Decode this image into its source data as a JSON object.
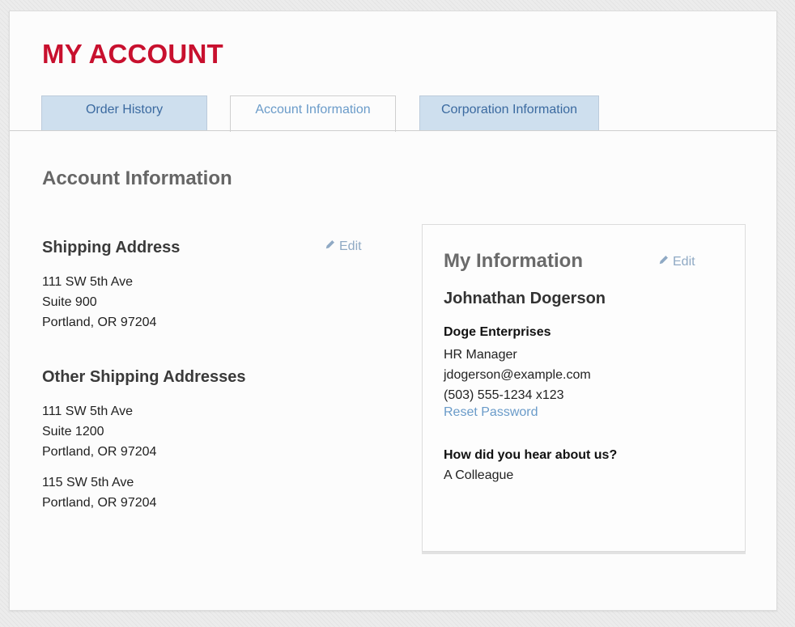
{
  "page": {
    "title": "MY ACCOUNT"
  },
  "tabs": [
    {
      "label": "Order History"
    },
    {
      "label": "Account Information"
    },
    {
      "label": "Corporation Information"
    }
  ],
  "main": {
    "section_title": "Account Information",
    "edit_label": "Edit",
    "shipping": {
      "title": "Shipping Address",
      "lines": [
        "111 SW 5th Ave",
        "Suite 900",
        "Portland, OR 97204"
      ]
    },
    "other_shipping": {
      "title": "Other Shipping Addresses",
      "addresses": [
        {
          "lines": [
            "111 SW 5th Ave",
            "Suite 1200",
            "Portland, OR 97204"
          ]
        },
        {
          "lines": [
            "115 SW 5th Ave",
            "Portland, OR 97204"
          ]
        }
      ]
    }
  },
  "my_info": {
    "title": "My Information",
    "name": "Johnathan Dogerson",
    "company": "Doge Enterprises",
    "role": "HR Manager",
    "email": "jdogerson@example.com",
    "phone": "(503) 555-1234 x123",
    "reset_password": "Reset Password",
    "hear_question": "How did you hear about us?",
    "hear_answer": "A Colleague"
  },
  "colors": {
    "brand": "#c8102e",
    "link": "#6a9bc9",
    "tab_bg": "#cedfee"
  },
  "icons": {
    "edit": "pencil-icon"
  }
}
